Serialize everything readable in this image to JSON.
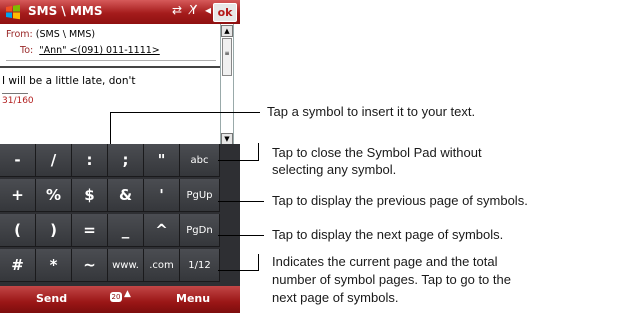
{
  "titlebar": {
    "title": "SMS \\ MMS",
    "status_icons": "⇄ Y̸ ◂ε",
    "ok_label": "ok"
  },
  "message": {
    "from_label": "From:",
    "from_value": "(SMS \\ MMS)",
    "to_label": "To:",
    "to_value": "\"Ann\" <(091) 011-1111>",
    "body": "I will be a little late, don't",
    "counter": "31/160"
  },
  "symbol_pad": {
    "rows": [
      [
        "-",
        "/",
        ":",
        ";",
        "\"",
        "abc"
      ],
      [
        "+",
        "%",
        "$",
        "&",
        "'",
        "PgUp"
      ],
      [
        "(",
        ")",
        "=",
        "_",
        "^",
        "PgDn"
      ],
      [
        "#",
        "*",
        "~",
        "www.",
        ".com",
        "1/12"
      ]
    ]
  },
  "softkeys": {
    "left": "Send",
    "input_icon": "20",
    "right": "Menu"
  },
  "callouts": {
    "insert": "Tap a symbol to insert it to your text.",
    "close_l1": "Tap to close the Symbol Pad without",
    "close_l2": "selecting any symbol.",
    "prev": "Tap to display the previous page of symbols.",
    "next": "Tap to display the next page of symbols.",
    "page_l1": "Indicates the current page and the total",
    "page_l2": "number of symbol pages. Tap to go to the",
    "page_l3": "next page of symbols."
  }
}
